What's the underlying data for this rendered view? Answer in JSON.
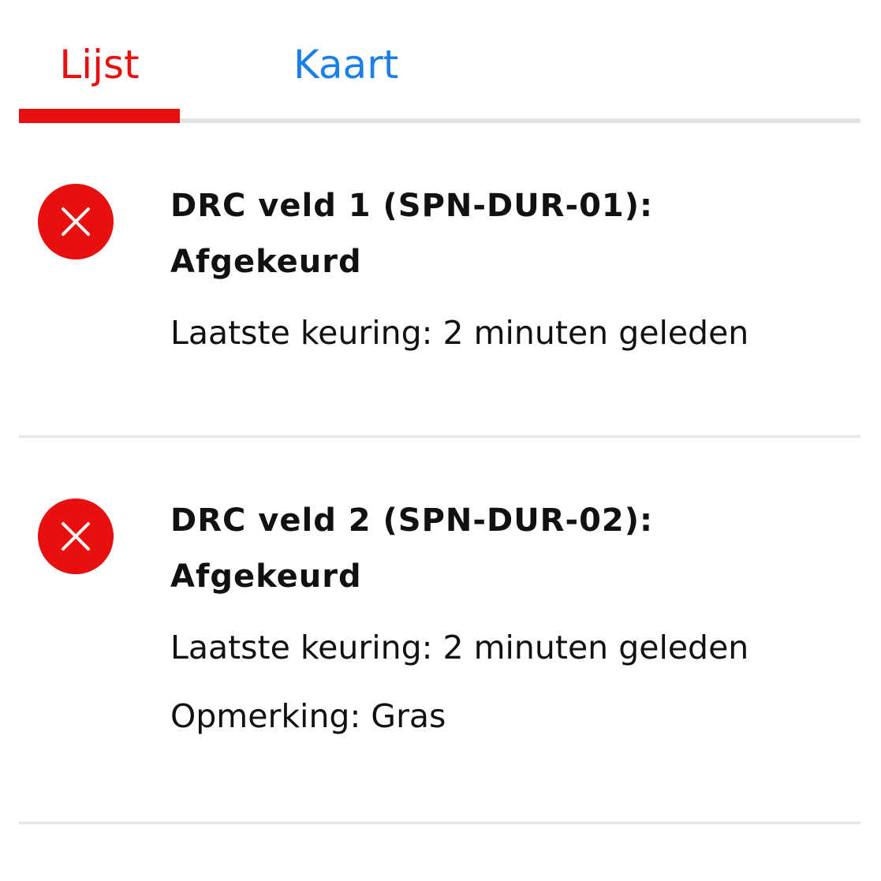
{
  "tabs": {
    "items": [
      {
        "label": "Lijst",
        "active": true
      },
      {
        "label": "Kaart",
        "active": false
      }
    ],
    "active_color": "#e8100f",
    "inactive_color": "#1a7fe6"
  },
  "fields": [
    {
      "status_icon": "close-icon",
      "status_color": "#e8100f",
      "title": "DRC veld 1 (SPN-DUR-01): Afgekeurd",
      "last_check": "Laatste keuring: 2 minuten geleden"
    },
    {
      "status_icon": "close-icon",
      "status_color": "#e8100f",
      "title": "DRC veld 2 (SPN-DUR-02): Afgekeurd",
      "last_check": "Laatste keuring: 2 minuten geleden",
      "remark": "Opmerking: Gras"
    }
  ]
}
